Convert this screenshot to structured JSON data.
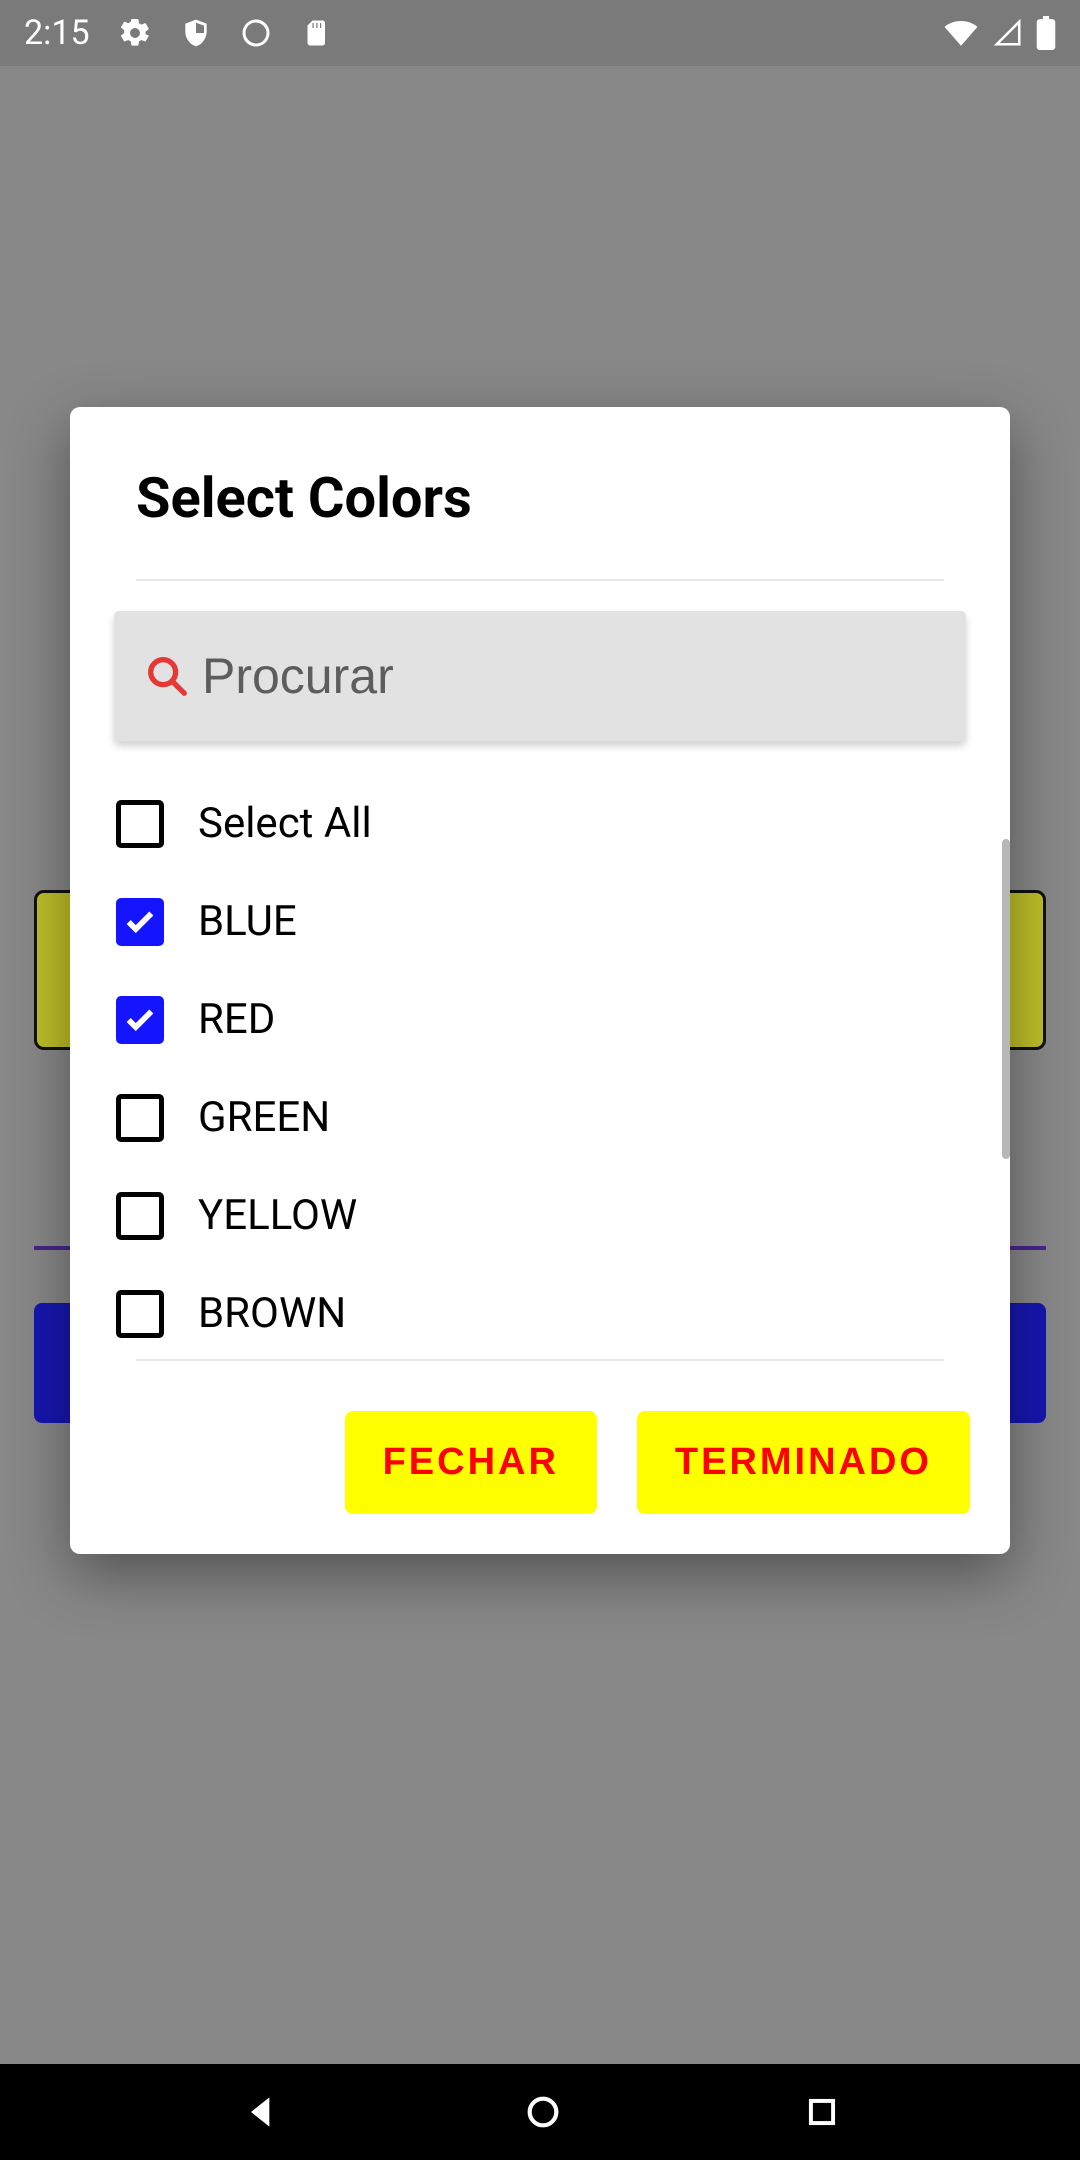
{
  "status": {
    "time": "2:15",
    "icons_left": [
      "settings-icon",
      "shield-icon",
      "sync-icon",
      "sd-card-icon"
    ],
    "icons_right": [
      "wifi-icon",
      "cell-signal-icon",
      "battery-icon"
    ]
  },
  "dialog": {
    "title": "Select Colors",
    "search": {
      "placeholder": "Procurar",
      "value": ""
    },
    "select_all_label": "Select All",
    "items": [
      {
        "label": "BLUE",
        "checked": true
      },
      {
        "label": "RED",
        "checked": true
      },
      {
        "label": "GREEN",
        "checked": false
      },
      {
        "label": "YELLOW",
        "checked": false
      },
      {
        "label": "BROWN",
        "checked": false
      }
    ],
    "buttons": {
      "close": "FECHAR",
      "done": "TERMINADO"
    }
  },
  "colors": {
    "accent_checkbox": "#1414ff",
    "button_bg": "#ffff00",
    "button_fg": "#ff0000",
    "search_icon": "#e53935"
  }
}
